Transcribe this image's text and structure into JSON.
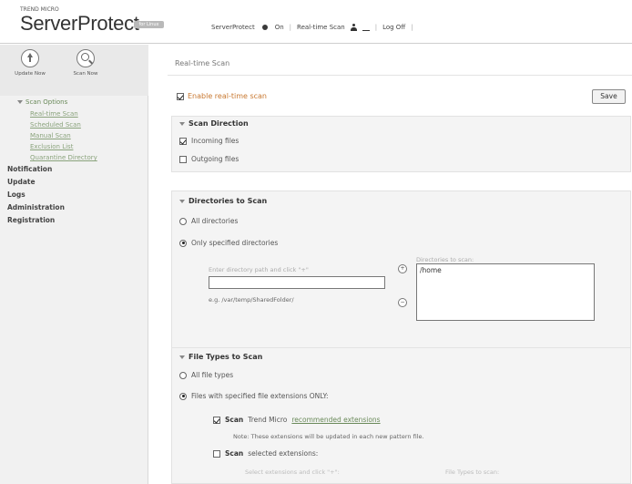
{
  "header": {
    "brand_small": "TREND MICRO",
    "brand": "ServerProtect",
    "brand_badge": "for Linux",
    "nav": {
      "realtime_status_prefix": "ServerProtect",
      "realtime_status_value": "On",
      "realtime_scan_link": "Real-time Scan",
      "logoff": "Log Off"
    }
  },
  "sidebar": {
    "tools": [
      {
        "label": "Update Now",
        "icon": "update-arrow-icon"
      },
      {
        "label": "Scan Now",
        "icon": "magnifier-icon"
      }
    ],
    "scan_options_label": "Scan Options",
    "scan_options_items": [
      "Real-time Scan",
      "Scheduled Scan",
      "Manual Scan",
      "Exclusion List",
      "Quarantine Directory"
    ],
    "top_items": [
      "Notification",
      "Update",
      "Logs",
      "Administration",
      "Registration"
    ]
  },
  "main": {
    "title": "Real-time Scan",
    "enable_label": "Enable real-time scan",
    "save_label": "Save",
    "scan_direction": {
      "heading": "Scan Direction",
      "incoming": "Incoming files",
      "outgoing": "Outgoing files"
    },
    "directories": {
      "heading": "Directories to Scan",
      "all": "All directories",
      "specified": "Only specified directories",
      "enter_label": "Enter directory path and click \"+\"",
      "example": "e.g. /var/temp/SharedFolder/",
      "list_label": "Directories to scan:",
      "list_values": [
        "/home"
      ]
    },
    "file_types": {
      "heading": "File Types to Scan",
      "all": "All file types",
      "specified": "Files with specified file extensions ONLY:",
      "scan_recommended_bold": "Scan",
      "scan_recommended_text": "Trend Micro",
      "scan_recommended_link": "recommended extensions",
      "note": "Note: These extensions will be updated in each new pattern file.",
      "scan_selected_bold": "Scan",
      "scan_selected_text": "selected extensions:",
      "faded_left": "Select extensions and click \"+\":",
      "faded_right": "File Types to scan:"
    }
  },
  "colors": {
    "accent_orange": "#c87830",
    "link_green": "#6a8a5a",
    "sidebar_bg": "#f1f1f1"
  }
}
